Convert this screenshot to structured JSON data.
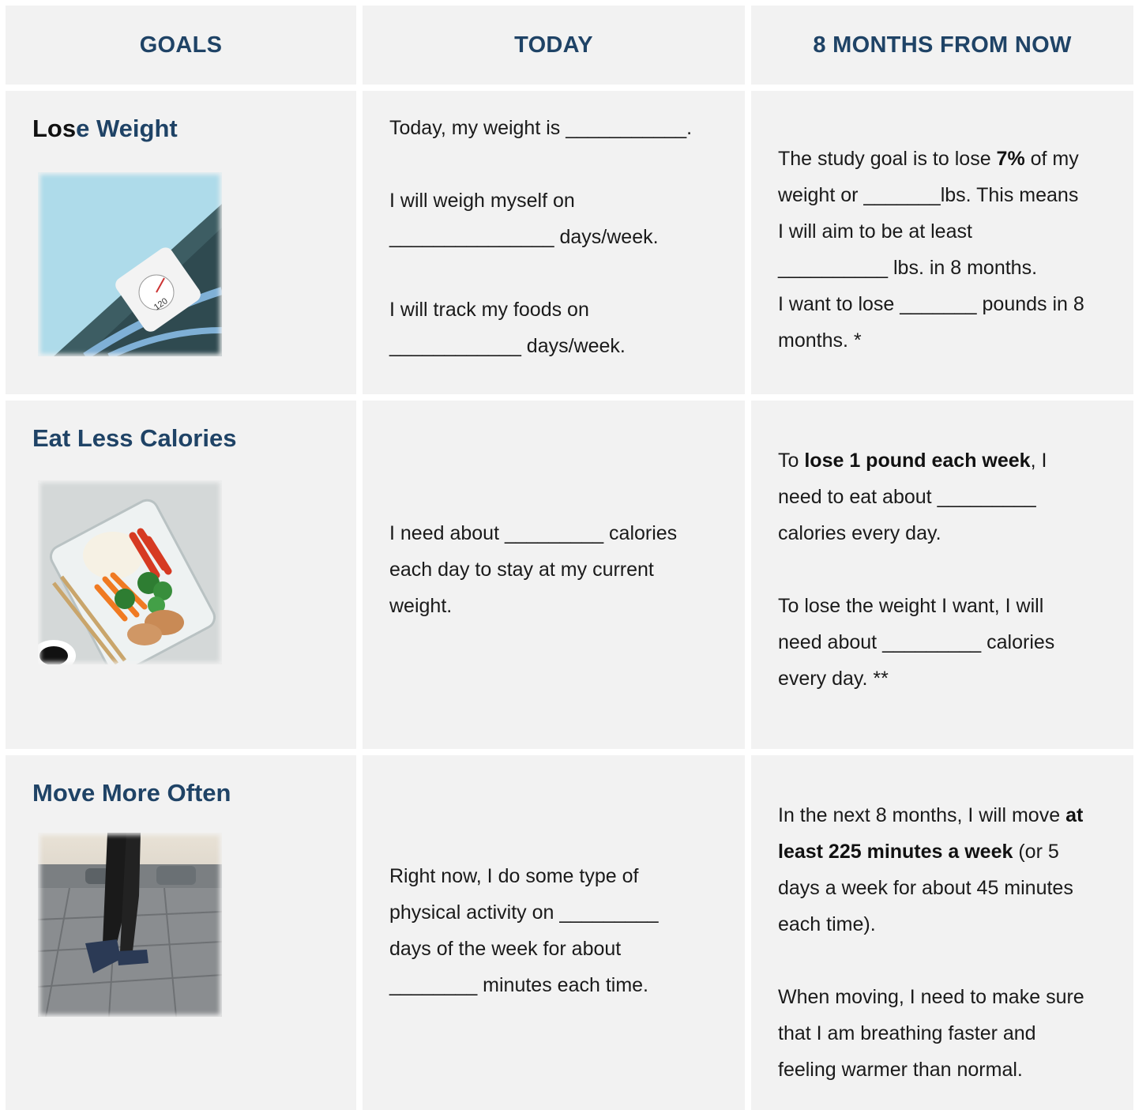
{
  "headers": {
    "goals": "GOALS",
    "today": "TODAY",
    "future": "8 MONTHS FROM NOW"
  },
  "rows": {
    "weight": {
      "title_a": "Los",
      "title_b": "e Weight",
      "image_icon": "bathroom-scale-image",
      "today_line1": "Today, my weight is ___________.",
      "today_line2": "I will weigh myself on",
      "today_line3": "_______________ days/week.",
      "today_line4": "I will track my foods on",
      "today_line5": "____________ days/week.",
      "future_a1": "The study goal is to lose ",
      "future_a_bold": "7%",
      "future_a2": " of my",
      "future_b": "weight or _______lbs. This means",
      "future_c": "I will aim to be at least",
      "future_d": "__________ lbs. in 8 months.",
      "future_e": "I want to lose _______ pounds in 8",
      "future_f": "months. *"
    },
    "calories": {
      "title": "Eat Less Calories",
      "image_icon": "meal-prep-container-image",
      "today_line1": "I need about _________ calories",
      "today_line2": "each day to stay at my current",
      "today_line3": "weight.",
      "future_a1": "To ",
      "future_a_bold": "lose 1 pound each week",
      "future_a2": ", I",
      "future_b": "need to eat about _________",
      "future_c": "calories every day.",
      "future_d": "To lose the weight I want, I will",
      "future_e": "need about _________ calories",
      "future_f": "every day. **"
    },
    "move": {
      "title": "Move More Often",
      "image_icon": "walking-legs-image",
      "today_line1": "Right now, I do some type of",
      "today_line2": "physical activity on _________",
      "today_line3": "days of the week for about",
      "today_line4": "________ minutes each time.",
      "future_a1": "In the next 8 months, I will move ",
      "future_a_bold1": "at",
      "future_b_bold": "least 225 minutes a week",
      "future_b2": " (or 5",
      "future_c": "days a week for about 45 minutes",
      "future_d": "each time).",
      "future_e": "When moving, I need to make sure",
      "future_f": "that I am breathing faster and",
      "future_g": "feeling warmer than normal."
    }
  },
  "colors": {
    "heading_blue": "#1f4366",
    "cell_bg": "#f2f2f2"
  }
}
